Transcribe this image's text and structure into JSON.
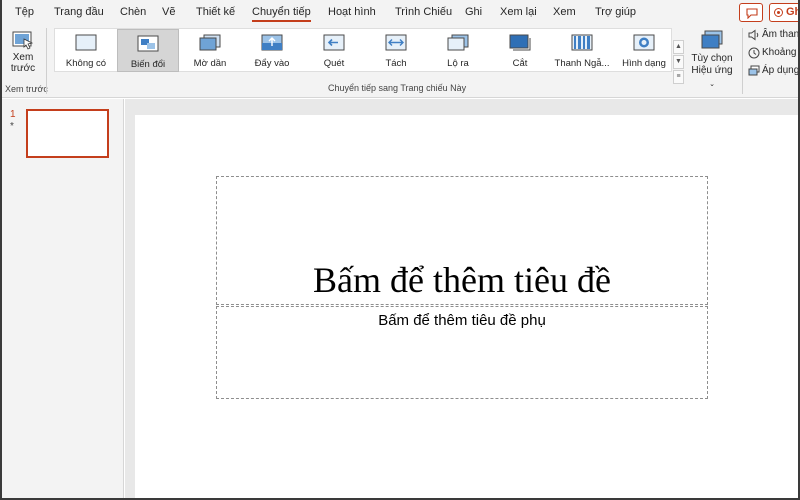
{
  "menu": {
    "tabs": [
      {
        "label": "Tệp"
      },
      {
        "label": "Trang đầu"
      },
      {
        "label": "Chèn"
      },
      {
        "label": "Vẽ"
      },
      {
        "label": "Thiết kế"
      },
      {
        "label": "Chuyển tiếp",
        "active": true
      },
      {
        "label": "Hoạt hình"
      },
      {
        "label": "Trình Chiếu"
      },
      {
        "label": "Ghi"
      },
      {
        "label": "Xem lại"
      },
      {
        "label": "Xem"
      },
      {
        "label": "Trợ giúp"
      }
    ],
    "record_label": "Ghi"
  },
  "ribbon": {
    "preview": {
      "line1": "Xem",
      "line2": "trước",
      "group_label": "Xem trước"
    },
    "transitions": {
      "items": [
        {
          "label": "Không có",
          "icon": "none-transition-icon"
        },
        {
          "label": "Biến đổi",
          "icon": "morph-transition-icon",
          "selected": true
        },
        {
          "label": "Mờ dần",
          "icon": "fade-transition-icon"
        },
        {
          "label": "Đẩy vào",
          "icon": "push-transition-icon"
        },
        {
          "label": "Quét",
          "icon": "wipe-transition-icon"
        },
        {
          "label": "Tách",
          "icon": "split-transition-icon"
        },
        {
          "label": "Lộ ra",
          "icon": "reveal-transition-icon"
        },
        {
          "label": "Cắt",
          "icon": "cut-transition-icon"
        },
        {
          "label": "Thanh Ngẫ...",
          "icon": "random-bars-transition-icon"
        },
        {
          "label": "Hình dạng",
          "icon": "shape-transition-icon"
        }
      ],
      "group_label": "Chuyển tiếp sang Trang chiếu Này"
    },
    "effect_options": {
      "line1": "Tùy chọn",
      "line2": "Hiệu ứng"
    },
    "timing": {
      "sound": "Âm thanh",
      "duration": "Khoảng t",
      "apply_all": "Áp dụng"
    }
  },
  "slides_panel": {
    "slide_number": "1",
    "star": "*"
  },
  "slide": {
    "title_placeholder": "Bấm để thêm tiêu đề",
    "subtitle_placeholder": "Bấm để thêm tiêu đề phụ"
  },
  "colors": {
    "accent": "#c43e1c",
    "ribbon_bg": "#f3f3f3",
    "canvas_bg": "#e8e8e8",
    "selected_item_bg": "#d5d5d5"
  }
}
